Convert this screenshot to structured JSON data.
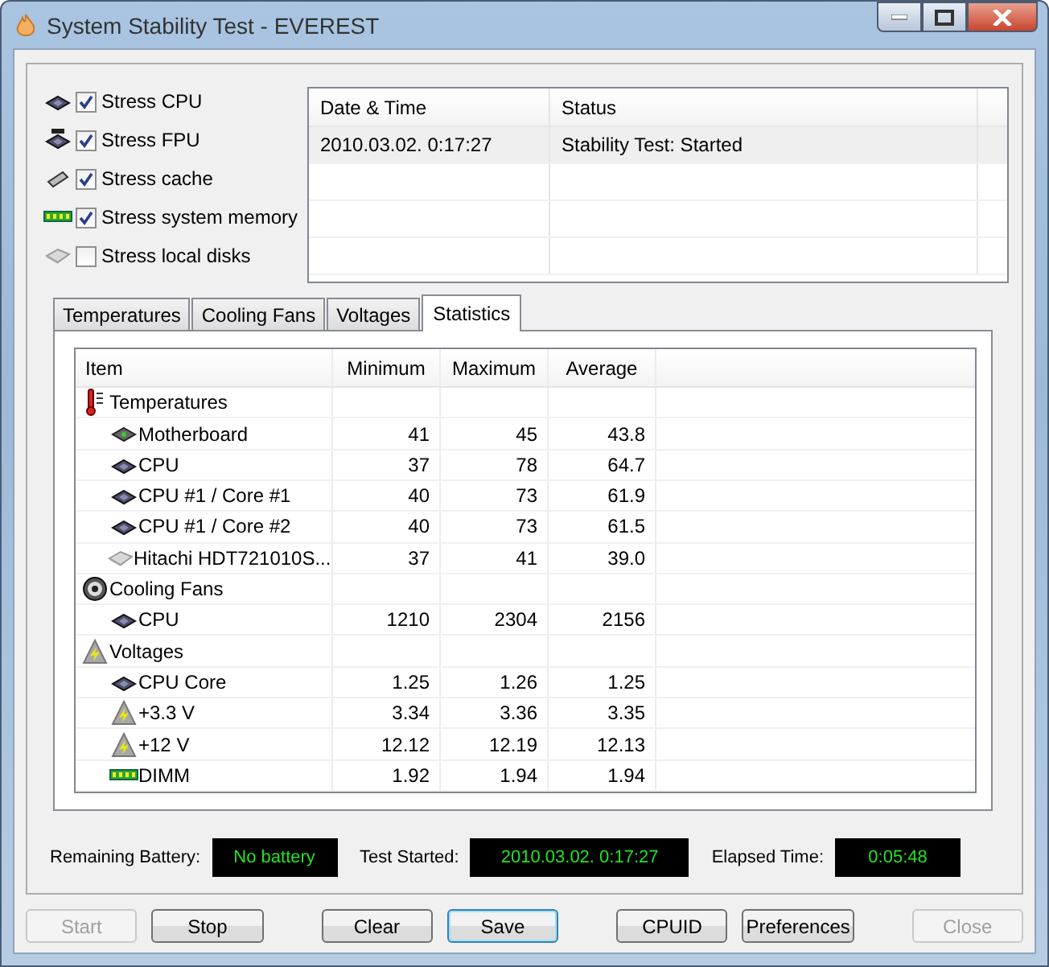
{
  "window": {
    "title": "System Stability Test - EVEREST"
  },
  "stress_options": [
    {
      "label": "Stress CPU",
      "kind": "cpu",
      "checked": true
    },
    {
      "label": "Stress FPU",
      "kind": "fpu",
      "checked": true
    },
    {
      "label": "Stress cache",
      "kind": "cache",
      "checked": true
    },
    {
      "label": "Stress system memory",
      "kind": "memory",
      "checked": true
    },
    {
      "label": "Stress local disks",
      "kind": "disk",
      "checked": false
    }
  ],
  "log": {
    "columns": [
      "Date & Time",
      "Status"
    ],
    "rows": [
      {
        "cells": [
          "2010.03.02. 0:17:27",
          "Stability Test: Started"
        ],
        "selected": true
      }
    ]
  },
  "tabs": [
    {
      "label": "Temperatures",
      "selected": false
    },
    {
      "label": "Cooling Fans",
      "selected": false
    },
    {
      "label": "Voltages",
      "selected": false
    },
    {
      "label": "Statistics",
      "selected": true
    }
  ],
  "table": {
    "columns": [
      "Item",
      "Minimum",
      "Maximum",
      "Average"
    ],
    "groups": [
      {
        "label": "Temperatures",
        "kind": "temperature",
        "children": [
          {
            "label": "Motherboard",
            "kind": "board",
            "cells": [
              "41",
              "45",
              "43.8"
            ]
          },
          {
            "label": "CPU",
            "kind": "cpu",
            "cells": [
              "37",
              "78",
              "64.7"
            ]
          },
          {
            "label": "CPU #1 / Core #1",
            "kind": "cpu",
            "cells": [
              "40",
              "73",
              "61.9"
            ]
          },
          {
            "label": "CPU #1 / Core #2",
            "kind": "cpu",
            "cells": [
              "40",
              "73",
              "61.5"
            ]
          },
          {
            "label": "Hitachi HDT721010S...",
            "kind": "disk",
            "cells": [
              "37",
              "41",
              "39.0"
            ]
          }
        ]
      },
      {
        "label": "Cooling Fans",
        "kind": "fan",
        "children": [
          {
            "label": "CPU",
            "kind": "cpu",
            "cells": [
              "1210",
              "2304",
              "2156"
            ]
          }
        ]
      },
      {
        "label": "Voltages",
        "kind": "voltage",
        "children": [
          {
            "label": "CPU Core",
            "kind": "cpu",
            "cells": [
              "1.25",
              "1.26",
              "1.25"
            ]
          },
          {
            "label": "+3.3 V",
            "kind": "voltage",
            "cells": [
              "3.34",
              "3.36",
              "3.35"
            ]
          },
          {
            "label": "+12 V",
            "kind": "voltage",
            "cells": [
              "12.12",
              "12.19",
              "12.13"
            ]
          },
          {
            "label": "DIMM",
            "kind": "memory",
            "cells": [
              "1.92",
              "1.94",
              "1.94"
            ]
          }
        ]
      }
    ]
  },
  "status": [
    {
      "label": "Remaining Battery:",
      "value": "No battery"
    },
    {
      "label": "Test Started:",
      "value": "2010.03.02. 0:17:27"
    },
    {
      "label": "Elapsed Time:",
      "value": "0:05:48"
    }
  ],
  "buttons": [
    {
      "label": "Start",
      "disabled": true,
      "default": false
    },
    {
      "label": "Stop",
      "disabled": false,
      "default": false
    },
    {
      "label": "Clear",
      "disabled": false,
      "default": false
    },
    {
      "label": "Save",
      "disabled": false,
      "default": true
    },
    {
      "label": "CPUID",
      "disabled": false,
      "default": false
    },
    {
      "label": "Preferences",
      "disabled": false,
      "default": false
    },
    {
      "label": "Close",
      "disabled": true,
      "default": false
    }
  ]
}
